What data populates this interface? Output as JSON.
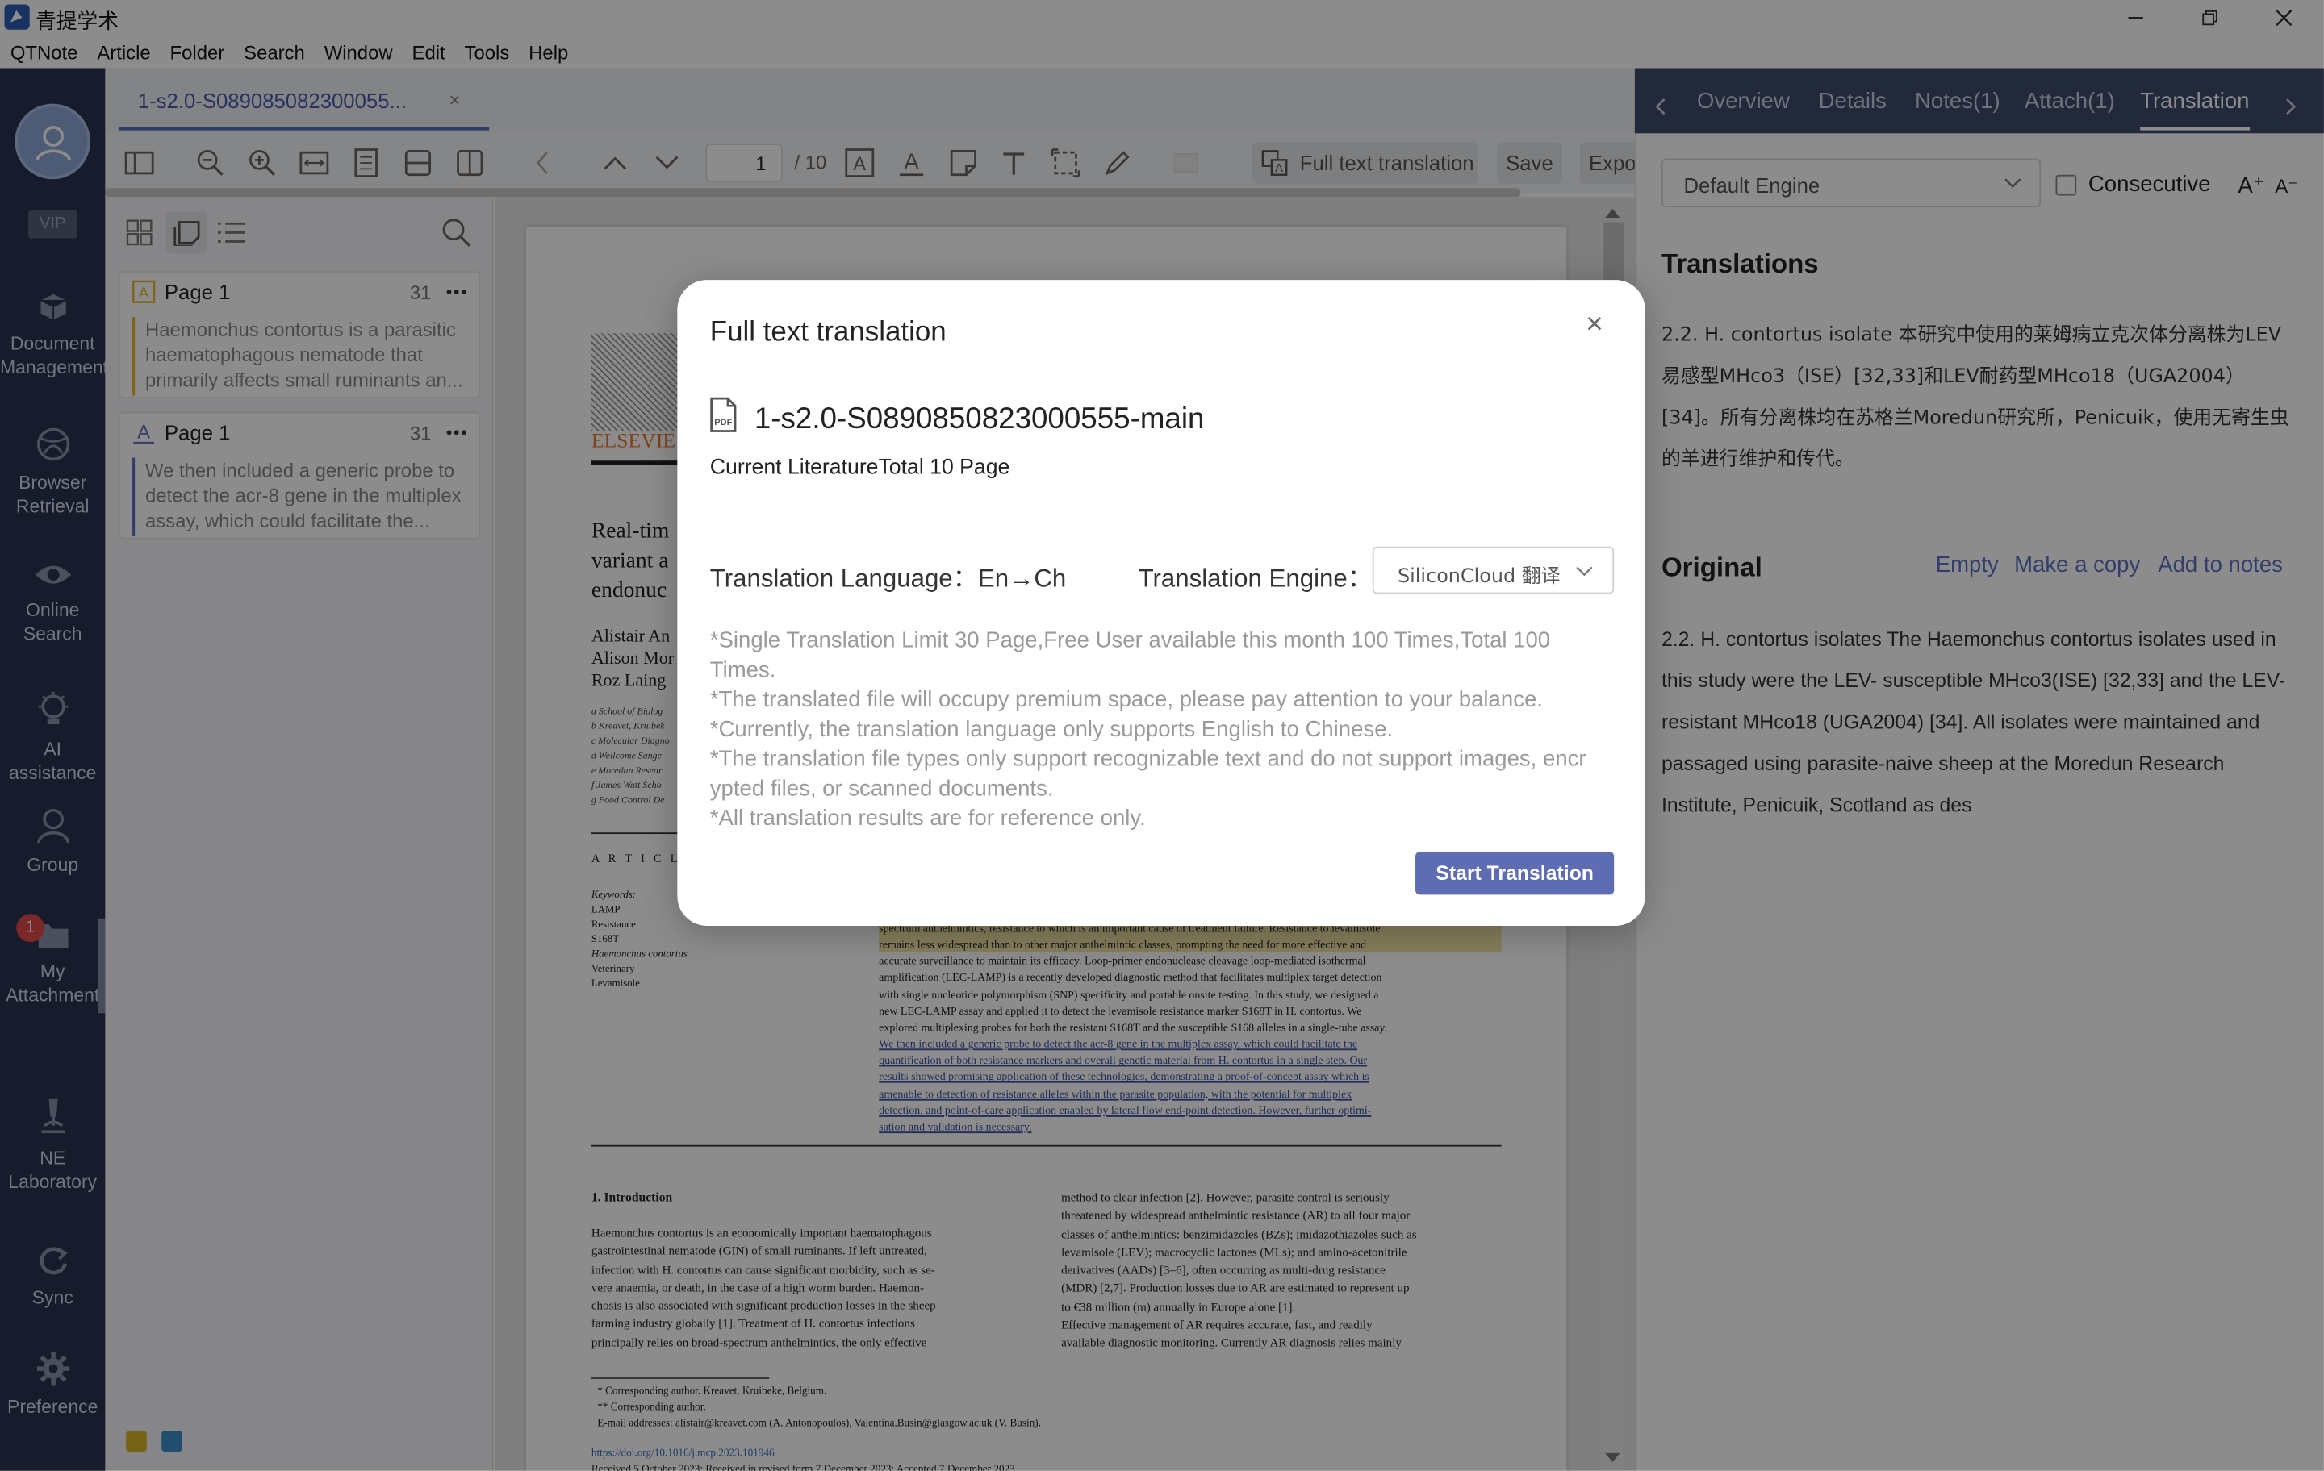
{
  "window": {
    "title": "青提学术"
  },
  "menu": [
    "QTNote",
    "Article",
    "Folder",
    "Search",
    "Window",
    "Edit",
    "Tools",
    "Help"
  ],
  "nav": {
    "vip": "VIP",
    "items": [
      {
        "label1": "Document",
        "label2": "Management"
      },
      {
        "label1": "Browser",
        "label2": "Retrieval"
      },
      {
        "label1": "Online",
        "label2": "Search"
      },
      {
        "label1": "AI assistance",
        "label2": ""
      },
      {
        "label1": "Group",
        "label2": ""
      },
      {
        "label1": "My",
        "label2": "Attachment",
        "badge": "1"
      },
      {
        "label1": "NE",
        "label2": "Laboratory"
      },
      {
        "label1": "Sync",
        "label2": ""
      },
      {
        "label1": "Preference",
        "label2": ""
      }
    ]
  },
  "tab": {
    "label": "1-s2.0-S089085082300055...",
    "close": "×"
  },
  "toolbar": {
    "page_current": "1",
    "page_total": "/ 10",
    "full_text_translation": "Full text translation",
    "save": "Save",
    "export": "Expo"
  },
  "annotations": [
    {
      "page": "Page 1",
      "count": "31",
      "text": "Haemonchus contortus is a parasitic haematophagous nematode that primarily affects small ruminants an...",
      "color": "#e8b93a"
    },
    {
      "page": "Page 1",
      "count": "31",
      "text": "We then included a generic probe to detect the acr-8 gene in the multiplex assay, which could facilitate the...",
      "color": "#5f72c4"
    }
  ],
  "document": {
    "publisher": "ELSEVIE",
    "title_lines": [
      "Real-tim",
      "variant a",
      "endonuc"
    ],
    "author_lines": [
      "Alistair An",
      "Alison Mor",
      "Roz Laing"
    ],
    "affiliations": [
      "a School of Biolog",
      "b Kreavet, Kruibek",
      "c Molecular Diagno",
      "d Wellcome Sange",
      "e Moredun Resear",
      "f James Watt Scho",
      "g Food Control De"
    ],
    "article_info": "A R T I C L E",
    "keywords_label": "Keywords:",
    "keywords": [
      "LAMP",
      "Resistance",
      "S168T",
      "Haemonchus contortus",
      "Veterinary",
      "Levamisole"
    ],
    "abstract_lines": [
      "spectrum anthelmintics, resistance to which is an important cause of treatment failure. Resistance to levamisole",
      "remains less widespread than to other major anthelmintic classes, prompting the need for more effective and",
      "accurate surveillance to maintain its efficacy. Loop-primer endonuclease cleavage loop-mediated isothermal",
      "amplification (LEC-LAMP) is a recently developed diagnostic method that facilitates multiplex target detection",
      "with single nucleotide polymorphism (SNP) specificity and portable onsite testing. In this study, we designed a",
      "new LEC-LAMP assay and applied it to detect the levamisole resistance marker S168T in H. contortus. We",
      "explored multiplexing probes for both the resistant S168T and the susceptible S168 alleles in a single-tube assay.",
      "We then included a generic probe to detect the acr-8 gene in the multiplex assay, which could facilitate the",
      "quantification of both resistance markers and overall genetic material from H. contortus in a single step. Our",
      "results showed promising application of these technologies, demonstrating a proof-of-concept assay which is",
      "amenable to detection of resistance alleles within the parasite population, with the potential for multiplex",
      "detection, and point-of-care application enabled by lateral flow end-point detection. However, further optimi-",
      "sation and validation is necessary."
    ],
    "intro_heading": "1.  Introduction",
    "intro_left": [
      "    Haemonchus contortus is an economically important haematophagous",
      "gastrointestinal nematode (GIN) of small ruminants. If left untreated,",
      "infection with H. contortus can cause significant morbidity, such as se-",
      "vere anaemia, or death, in the case of a high worm burden. Haemon-",
      "chosis is also associated with significant production losses in the sheep",
      "farming industry globally [1]. Treatment of H. contortus infections",
      "principally relies on broad-spectrum anthelmintics, the only effective"
    ],
    "intro_right": [
      "method to clear infection [2]. However, parasite control is seriously",
      "threatened by widespread anthelmintic resistance (AR) to all four major",
      "classes of anthelmintics: benzimidazoles (BZs); imidazothiazoles such as",
      "levamisole (LEV); macrocyclic lactones (MLs); and amino-acetonitrile",
      "derivatives (AADs) [3–6], often occurring as multi-drug resistance",
      "(MDR) [2,7]. Production losses due to AR are estimated to represent up",
      "to €38 million (m) annually in Europe alone [1].",
      "    Effective management of AR requires accurate, fast, and readily",
      "available diagnostic monitoring. Currently AR diagnosis relies mainly"
    ],
    "footnotes": [
      "* Corresponding author. Kreavet, Kruibeke, Belgium.",
      "** Corresponding author.",
      "E-mail addresses: alistair@kreavet.com (A. Antonopoulos), Valentina.Busin@glasgow.ac.uk (V. Busin)."
    ],
    "doi": "https://doi.org/10.1016/j.mcp.2023.101946",
    "received": "Received 5 October 2023; Received in revised form 7 December 2023; Accepted 7 December 2023"
  },
  "right_panel": {
    "tabs": [
      "Overview",
      "Details",
      "Notes(1)",
      "Attach(1)",
      "Translation"
    ],
    "active_tab": "Translation",
    "engine": "Default Engine",
    "consecutive": "Consecutive",
    "font_up": "A⁺",
    "font_down": "A⁻",
    "translations_heading": "Translations",
    "translation_text": "2.2. H. contortus isolate 本研究中使用的莱姆病立克次体分离株为LEV易感型MHco3（ISE）[32,33]和LEV耐药型MHco18（UGA2004）[34]。所有分离株均在苏格兰Moredun研究所，Penicuik，使用无寄生虫的羊进行维护和传代。",
    "original_heading": "Original",
    "actions": [
      "Empty",
      "Make a copy",
      "Add to notes"
    ],
    "original_text": "2.2. H. contortus isolates The Haemonchus contortus isolates used in this study were the LEV- susceptible MHco3(ISE) [32,33] and the LEV-resistant MHco18 (UGA2004) [34]. All isolates were maintained and passaged using parasite-naive sheep at the Moredun Research Institute, Penicuik, Scotland as des"
  },
  "modal": {
    "title": "Full text translation",
    "close": "×",
    "file_name": "1-s2.0-S0890850823000555-main",
    "current": "Current LiteratureTotal 10 Page",
    "lang_label": "Translation Language：En→Ch",
    "engine_label": "Translation Engine：",
    "engine_value": "SiliconCloud 翻译",
    "notes": [
      "*Single Translation Limit 30 Page,Free User available this month 100 Times,Total 100 Times.",
      "*The translated file will occupy premium space, please pay attention to your balance.",
      "*Currently, the translation language only supports English to Chinese.",
      "*The translation file types only support recognizable text and do not support images, encr",
      "ypted files, or scanned documents.",
      "*All translation results are for reference only."
    ],
    "start": "Start Translation"
  }
}
